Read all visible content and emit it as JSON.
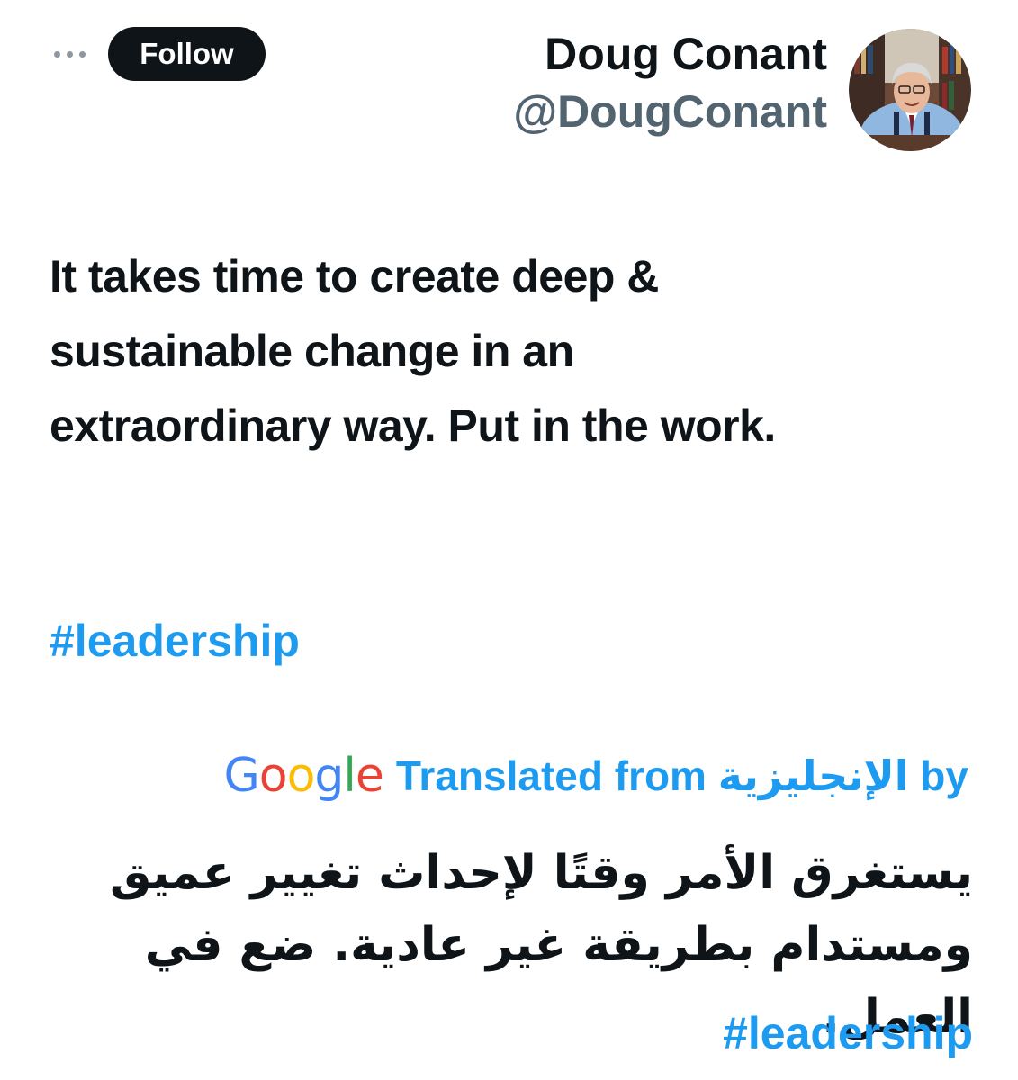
{
  "header": {
    "more_icon": "more-horizontal-icon",
    "follow_label": "Follow",
    "display_name": "Doug Conant",
    "handle": "@DougConant",
    "avatar_alt": "Doug Conant"
  },
  "tweet": {
    "text": "It takes time to create deep & sustainable change in an extraordinary way. Put in the work.",
    "hashtag": "#leadership"
  },
  "translation": {
    "google_logo_letters": [
      "G",
      "o",
      "o",
      "g",
      "l",
      "e"
    ],
    "google_colors": [
      "#4285F4",
      "#EA4335",
      "#FBBC05",
      "#4285F4",
      "#34A853",
      "#EA4335"
    ],
    "label": "Translated from الإنجليزية by",
    "text": "يستغرق الأمر وقتًا لإحداث تغيير عميق ومستدام بطريقة غير عادية. ضع في العمل.",
    "hashtag": "#leadership"
  },
  "colors": {
    "accent": "#1d9bf0",
    "text": "#0f1419",
    "secondary": "#536471",
    "button_bg": "#0f1419"
  }
}
